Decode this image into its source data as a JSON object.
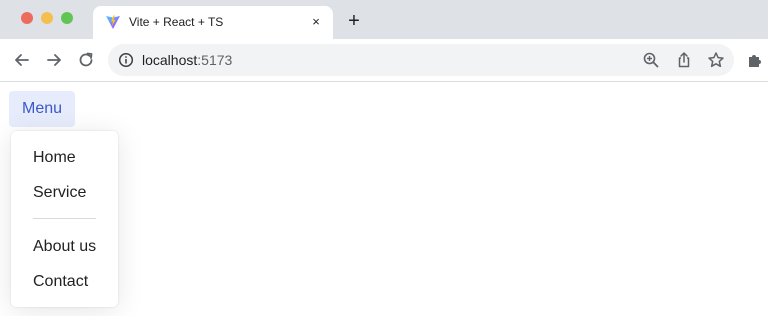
{
  "browser": {
    "tab": {
      "title": "Vite + React + TS",
      "close_glyph": "×"
    },
    "new_tab_glyph": "+",
    "address": {
      "host": "localhost",
      "port": ":5173"
    },
    "icons": {
      "favicon": "vite-logo-icon",
      "back": "arrow-left-icon",
      "forward": "arrow-right-icon",
      "reload": "reload-icon",
      "info": "info-icon",
      "zoom": "zoom-icon",
      "share": "share-icon",
      "bookmark": "star-icon",
      "extensions": "puzzle-icon"
    }
  },
  "page": {
    "menu_button": {
      "label": "Menu"
    },
    "menu": {
      "items": [
        {
          "label": "Home"
        },
        {
          "label": "Service"
        },
        {
          "label": "About us"
        },
        {
          "label": "Contact"
        }
      ]
    }
  },
  "colors": {
    "tabstrip": "#dee1e6",
    "menu_button_bg": "#e6ecfb",
    "menu_button_text": "#3b59c7"
  }
}
